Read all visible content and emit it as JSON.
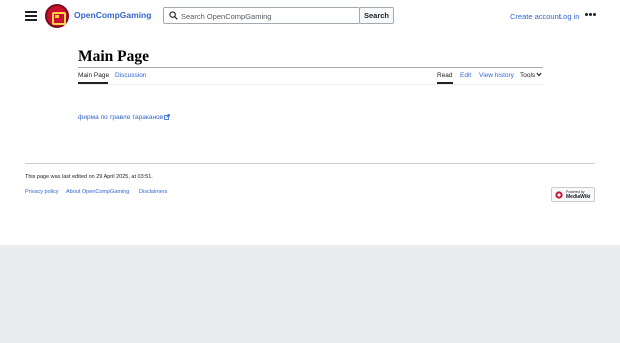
{
  "header": {
    "site_name": "OpenCompGaming",
    "search_placeholder": "Search OpenCompGaming",
    "search_button": "Search",
    "create_account": "Create account",
    "login": "Log in"
  },
  "page": {
    "title": "Main Page",
    "tabs_left": [
      {
        "label": "Main Page",
        "active": true
      },
      {
        "label": "Discussion",
        "active": false
      }
    ],
    "tabs_right": [
      {
        "label": "Read",
        "active": true
      },
      {
        "label": "Edit",
        "active": false
      },
      {
        "label": "View history",
        "active": false
      },
      {
        "label": "Tools",
        "active": false
      }
    ]
  },
  "content": {
    "link_text": "фирма по травле тараканов"
  },
  "footer": {
    "last_edited": "This page was last edited on 29 April 2025, at 03:51.",
    "links": [
      "Privacy policy",
      "About OpenCompGaming",
      "Disclaimers"
    ],
    "powered_small": "Powered by",
    "powered_big": "MediaWiki"
  },
  "colors": {
    "link": "#3366cc",
    "text": "#202122",
    "logo": "#c8102e"
  }
}
